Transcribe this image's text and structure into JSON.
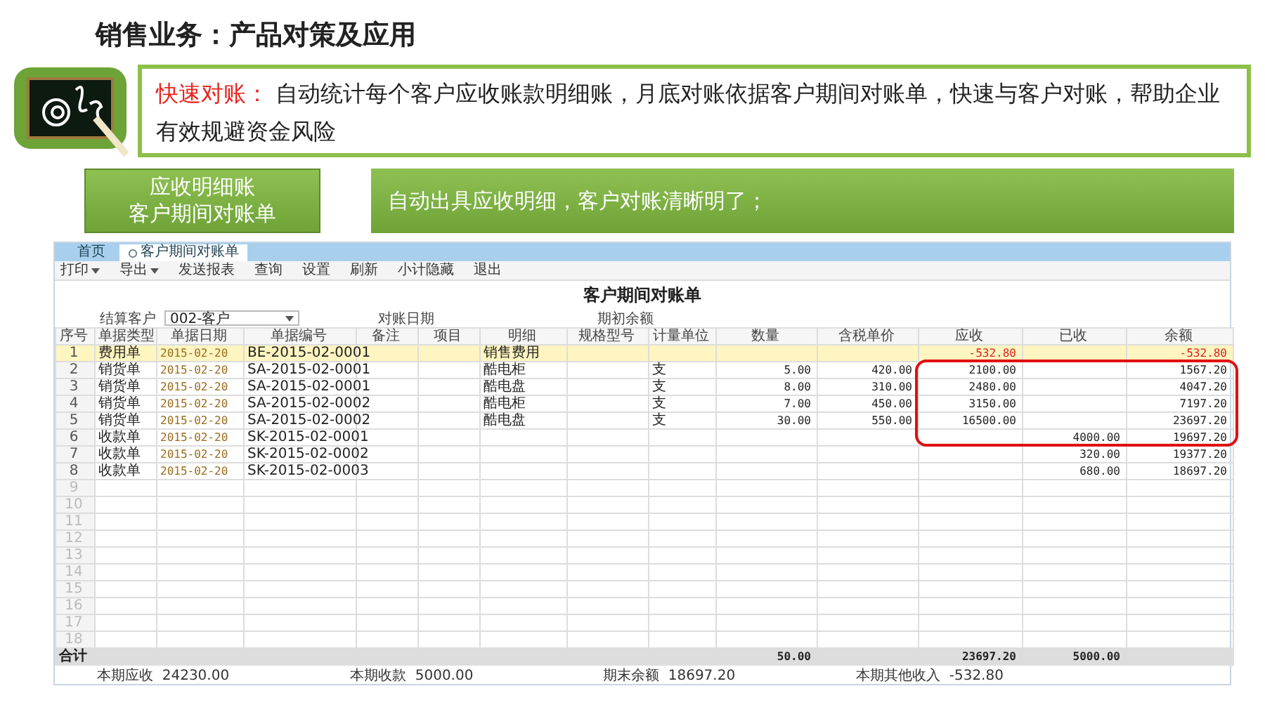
{
  "slide_title": "销售业务：产品对策及应用",
  "callout": {
    "label": "快速对账：",
    "text": "自动统计每个客户应收账款明细账，月底对账依据客户期间对账单，快速与客户对账，帮助企业有效规避资金风险"
  },
  "feature_tag": [
    "应收明细账",
    "客户期间对账单"
  ],
  "feature_text": "自动出具应收明细，客户对账清晰明了；",
  "app": {
    "tabs": [
      {
        "label": "首页",
        "selected": false
      },
      {
        "label": "客户期间对账单",
        "selected": true
      }
    ],
    "toolbar": [
      {
        "label": "打印",
        "dropdown": true
      },
      {
        "label": "导出",
        "dropdown": true
      },
      {
        "label": "发送报表",
        "dropdown": false
      },
      {
        "label": "查询",
        "dropdown": false
      },
      {
        "label": "设置",
        "dropdown": false
      },
      {
        "label": "刷新",
        "dropdown": false
      },
      {
        "label": "小计隐藏",
        "dropdown": false
      },
      {
        "label": "退出",
        "dropdown": false
      }
    ],
    "report_title": "客户期间对账单",
    "filters": [
      {
        "label": "结算客户",
        "value": "002-客户"
      },
      {
        "label": "对账日期"
      },
      {
        "label": "期初余额"
      }
    ],
    "table": {
      "columns": [
        "序号",
        "单据类型",
        "单据日期",
        "单据编号",
        "备注",
        "项目",
        "明细",
        "规格型号",
        "计量单位",
        "数量",
        "含税单价",
        "应收",
        "已收",
        "余额"
      ],
      "rows": [
        {
          "selected": true,
          "warning": true,
          "cells": [
            "1",
            "费用单",
            "2015-02-20",
            "BE-2015-02-0001",
            null,
            null,
            "销售费用",
            null,
            null,
            null,
            null,
            "-532.80",
            null,
            "-532.80"
          ]
        },
        {
          "selected": false,
          "warning": false,
          "cells": [
            "2",
            "销货单",
            "2015-02-20",
            "SA-2015-02-0001",
            null,
            null,
            "酷电柜",
            null,
            "支",
            "5.00",
            "420.00",
            "2100.00",
            null,
            "1567.20"
          ]
        },
        {
          "selected": false,
          "warning": false,
          "cells": [
            "3",
            "销货单",
            "2015-02-20",
            "SA-2015-02-0001",
            null,
            null,
            "酷电盘",
            null,
            "支",
            "8.00",
            "310.00",
            "2480.00",
            null,
            "4047.20"
          ]
        },
        {
          "selected": false,
          "warning": false,
          "cells": [
            "4",
            "销货单",
            "2015-02-20",
            "SA-2015-02-0002",
            null,
            null,
            "酷电柜",
            null,
            "支",
            "7.00",
            "450.00",
            "3150.00",
            null,
            "7197.20"
          ]
        },
        {
          "selected": false,
          "warning": false,
          "cells": [
            "5",
            "销货单",
            "2015-02-20",
            "SA-2015-02-0002",
            null,
            null,
            "酷电盘",
            null,
            "支",
            "30.00",
            "550.00",
            "16500.00",
            null,
            "23697.20"
          ]
        },
        {
          "selected": false,
          "warning": false,
          "cells": [
            "6",
            "收款单",
            "2015-02-20",
            "SK-2015-02-0001",
            null,
            null,
            null,
            null,
            null,
            null,
            null,
            null,
            "4000.00",
            "19697.20"
          ]
        },
        {
          "selected": false,
          "warning": false,
          "cells": [
            "7",
            "收款单",
            "2015-02-20",
            "SK-2015-02-0002",
            null,
            null,
            null,
            null,
            null,
            null,
            null,
            null,
            "320.00",
            "19377.20"
          ]
        },
        {
          "selected": false,
          "warning": false,
          "cells": [
            "8",
            "收款单",
            "2015-02-20",
            "SK-2015-02-0003",
            null,
            null,
            null,
            null,
            null,
            null,
            null,
            null,
            "680.00",
            "18697.20"
          ]
        }
      ],
      "empty_rows": [
        "9",
        "10",
        "11",
        "12",
        "13",
        "14",
        "15",
        "16",
        "17",
        "18"
      ],
      "totals": {
        "label": "合计",
        "cells": [
          null,
          null,
          null,
          null,
          null,
          null,
          null,
          null,
          null,
          "50.00",
          null,
          "23697.20",
          "5000.00",
          null
        ]
      }
    },
    "summary": [
      {
        "label": "本期应收",
        "value": "24230.00"
      },
      {
        "label": "本期收款",
        "value": "5000.00"
      },
      {
        "label": "期末余额",
        "value": "18697.20"
      },
      {
        "label": "本期其他收入",
        "value": "-532.80"
      }
    ]
  }
}
